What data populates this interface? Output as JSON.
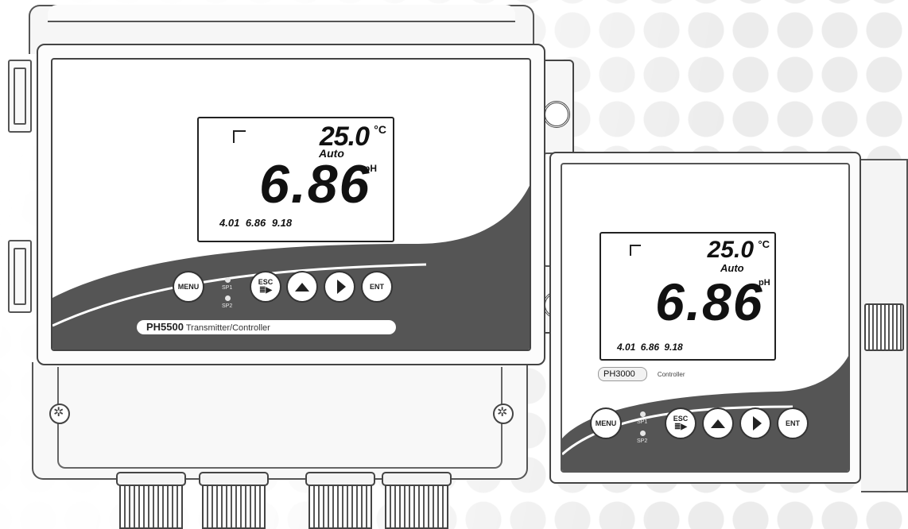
{
  "large_unit": {
    "model": "PH5500",
    "subtitle": "Transmitter/Controller",
    "display": {
      "temperature": "25.0",
      "temperature_unit": "°C",
      "mode": "Auto",
      "value": "6.86",
      "value_unit": "pH",
      "buffers": "4.01  6.86  9.18"
    },
    "buttons": {
      "menu": "MENU",
      "esc": "ESC",
      "up_icon": "up-arrow-icon",
      "right_icon": "right-arrow-icon",
      "ent": "ENT"
    },
    "leds": {
      "sp1": "SP1",
      "sp2": "SP2"
    }
  },
  "small_unit": {
    "model": "PH3000",
    "subtitle": "Controller",
    "display": {
      "temperature": "25.0",
      "temperature_unit": "°C",
      "mode": "Auto",
      "value": "6.86",
      "value_unit": "pH",
      "buffers": "4.01  6.86  9.18"
    },
    "buttons": {
      "menu": "MENU",
      "esc": "ESC",
      "up_icon": "up-arrow-icon",
      "right_icon": "right-arrow-icon",
      "ent": "ENT"
    },
    "leds": {
      "sp1": "SP1",
      "sp2": "SP2"
    }
  },
  "colors": {
    "panel_dark": "#555555",
    "outline": "#444444",
    "background_dots": "#ececec"
  }
}
